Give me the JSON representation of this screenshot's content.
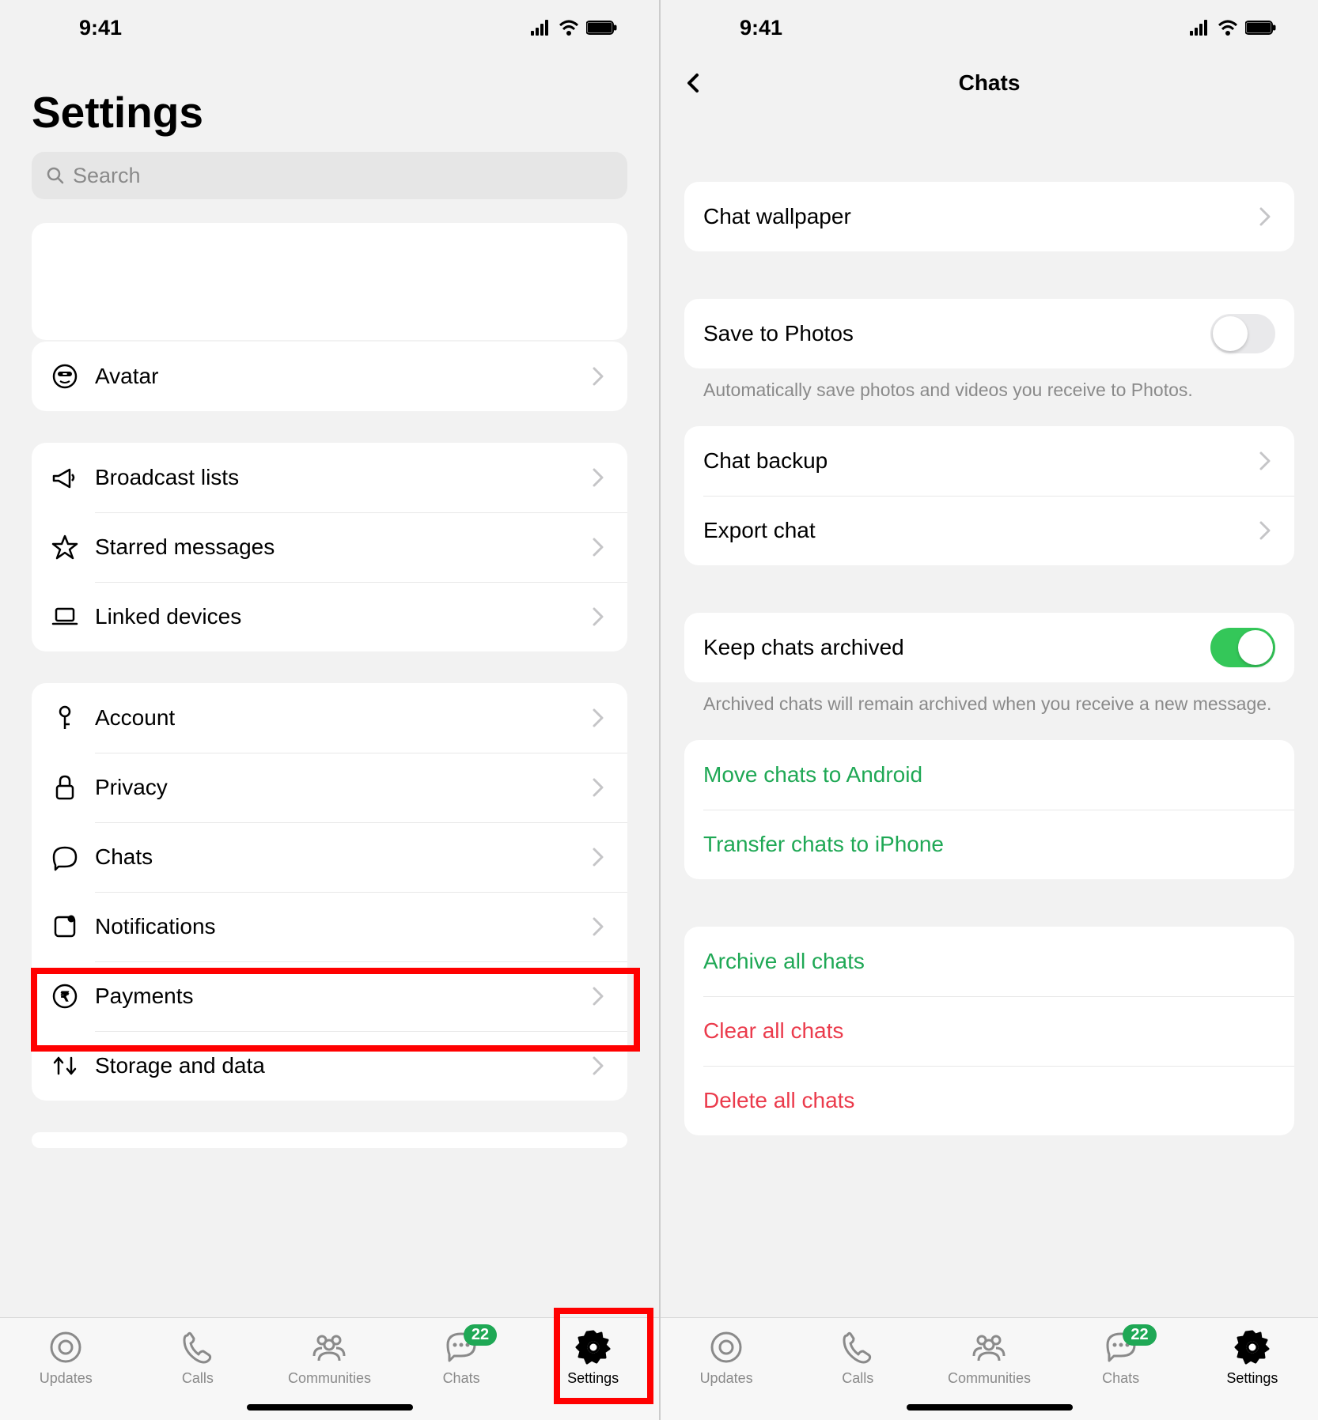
{
  "status": {
    "time": "9:41"
  },
  "screen1": {
    "title": "Settings",
    "search_placeholder": "Search",
    "rows": {
      "avatar": "Avatar",
      "broadcast": "Broadcast lists",
      "starred": "Starred messages",
      "linked": "Linked devices",
      "account": "Account",
      "privacy": "Privacy",
      "chats": "Chats",
      "notifications": "Notifications",
      "payments": "Payments",
      "storage": "Storage and data"
    }
  },
  "screen2": {
    "title": "Chats",
    "rows": {
      "wallpaper": "Chat wallpaper",
      "save_photos": "Save to Photos",
      "save_photos_caption": "Automatically save photos and videos you receive to Photos.",
      "backup": "Chat backup",
      "export": "Export chat",
      "keep_archived": "Keep chats archived",
      "keep_archived_caption": "Archived chats will remain archived when you receive a new message.",
      "move_android": "Move chats to Android",
      "transfer_iphone": "Transfer chats to iPhone",
      "archive_all": "Archive all chats",
      "clear_all": "Clear all chats",
      "delete_all": "Delete all chats"
    },
    "toggles": {
      "save_photos": false,
      "keep_archived": true
    }
  },
  "tabs": {
    "updates": "Updates",
    "calls": "Calls",
    "communities": "Communities",
    "chats": "Chats",
    "settings": "Settings",
    "chats_badge": "22"
  }
}
